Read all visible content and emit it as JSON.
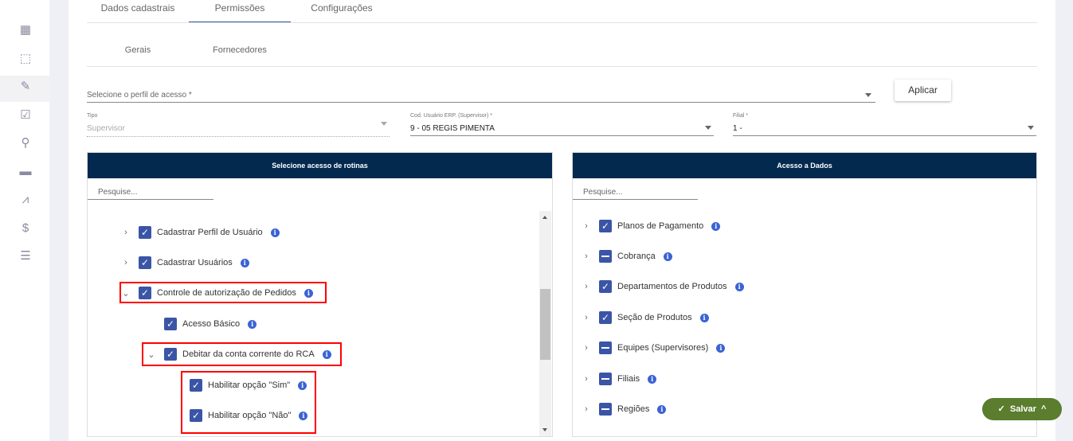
{
  "sidebar": {
    "icons": [
      "solar-panel-icon",
      "presentation-chart-icon",
      "edit-icon",
      "checklist-icon",
      "location-pin-icon",
      "wallet-icon",
      "area-chart-icon",
      "invoice-dollar-icon",
      "document-icon"
    ],
    "active_index": 2
  },
  "tabs": [
    {
      "label": "Dados cadastrais"
    },
    {
      "label": "Permissões",
      "active": true
    },
    {
      "label": "Configurações"
    }
  ],
  "subtabs": [
    {
      "label": "Gerais"
    },
    {
      "label": "Fornecedores"
    }
  ],
  "profile": {
    "placeholder": "Selecione o perfil de acesso *",
    "apply_label": "Aplicar"
  },
  "fields": {
    "tipo": {
      "label": "Tipo",
      "value": "Supervisor"
    },
    "cod": {
      "label": "Cod. Usuário ERP. (Supervisor) *",
      "value": "9 - 05 REGIS PIMENTA"
    },
    "filial": {
      "label": "Filial *",
      "value": "1 -"
    }
  },
  "routines": {
    "title": "Selecione acesso de rotinas",
    "search_placeholder": "Pesquise...",
    "items": [
      {
        "label": "Cadastrar Perfil de Usuário",
        "level": 0,
        "expand": "collapsed",
        "checked": "checked"
      },
      {
        "label": "Cadastrar Usuários",
        "level": 0,
        "expand": "collapsed",
        "checked": "checked"
      },
      {
        "label": "Controle de autorização de Pedidos",
        "level": 0,
        "expand": "expanded",
        "checked": "checked",
        "highlighted": true
      },
      {
        "label": "Acesso Básico",
        "level": 1,
        "expand": "none",
        "checked": "checked"
      },
      {
        "label": "Debitar da conta corrente do RCA",
        "level": 1,
        "expand": "expanded",
        "checked": "checked",
        "highlighted": true
      },
      {
        "label": "Habilitar opção \"Sim\"",
        "level": 2,
        "expand": "none",
        "checked": "checked",
        "highlighted": true
      },
      {
        "label": "Habilitar opção \"Não\"",
        "level": 2,
        "expand": "none",
        "checked": "checked",
        "highlighted": true
      }
    ]
  },
  "data_access": {
    "title": "Acesso a Dados",
    "search_placeholder": "Pesquise...",
    "items": [
      {
        "label": "Planos de Pagamento",
        "checked": "checked"
      },
      {
        "label": "Cobrança",
        "checked": "indeterminate"
      },
      {
        "label": "Departamentos de Produtos",
        "checked": "checked"
      },
      {
        "label": "Seção de Produtos",
        "checked": "checked"
      },
      {
        "label": "Equipes (Supervisores)",
        "checked": "indeterminate"
      },
      {
        "label": "Filiais",
        "checked": "indeterminate"
      },
      {
        "label": "Regiões",
        "checked": "indeterminate"
      }
    ]
  },
  "save_label": "Salvar",
  "colors": {
    "header": "#03294f",
    "checkbox": "#3b55a6",
    "save": "#5a7d2e",
    "highlight": "#ff0000"
  }
}
